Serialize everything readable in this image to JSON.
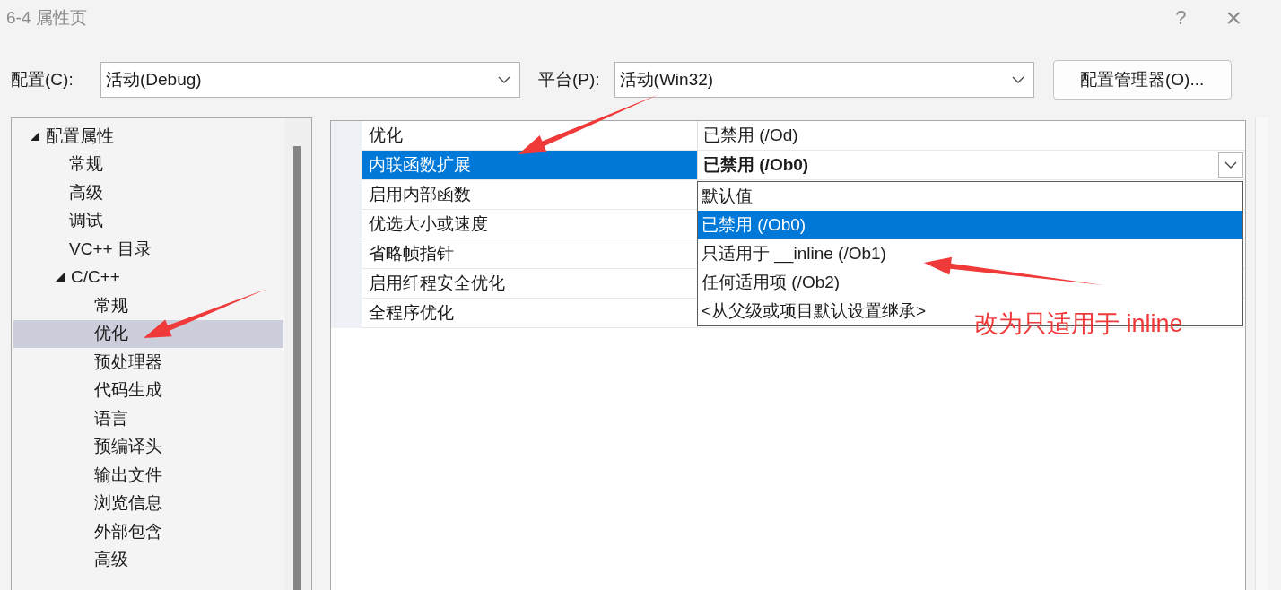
{
  "window": {
    "title": "6-4 属性页",
    "help": "?",
    "close": "×"
  },
  "config": {
    "label": "配置(C):",
    "value": "活动(Debug)"
  },
  "platform": {
    "label": "平台(P):",
    "value": "活动(Win32)"
  },
  "manager_button": "配置管理器(O)...",
  "tree": [
    {
      "label": "配置属性",
      "expanded": true,
      "selected": false,
      "children": [
        {
          "label": "常规",
          "selected": false
        },
        {
          "label": "高级",
          "selected": false
        },
        {
          "label": "调试",
          "selected": false
        },
        {
          "label": "VC++ 目录",
          "selected": false
        },
        {
          "label": "C/C++",
          "expanded": true,
          "selected": false,
          "children": [
            {
              "label": "常规",
              "selected": false
            },
            {
              "label": "优化",
              "selected": true
            },
            {
              "label": "预处理器",
              "selected": false
            },
            {
              "label": "代码生成",
              "selected": false
            },
            {
              "label": "语言",
              "selected": false
            },
            {
              "label": "预编译头",
              "selected": false
            },
            {
              "label": "输出文件",
              "selected": false
            },
            {
              "label": "浏览信息",
              "selected": false
            },
            {
              "label": "外部包含",
              "selected": false
            },
            {
              "label": "高级",
              "selected": false
            }
          ]
        }
      ]
    }
  ],
  "properties": [
    {
      "name": "优化",
      "value": "已禁用 (/Od)",
      "modified": false,
      "selected": false
    },
    {
      "name": "内联函数扩展",
      "value": "已禁用 (/Ob0)",
      "modified": true,
      "selected": true
    },
    {
      "name": "启用内部函数",
      "selected": false
    },
    {
      "name": "优选大小或速度",
      "selected": false
    },
    {
      "name": "省略帧指针",
      "selected": false
    },
    {
      "name": "启用纤程安全优化",
      "selected": false
    },
    {
      "name": "全程序优化",
      "selected": false
    }
  ],
  "dropdown": {
    "options": [
      {
        "label": "默认值",
        "selected": false
      },
      {
        "label": "已禁用 (/Ob0)",
        "selected": true
      },
      {
        "label": "只适用于 __inline (/Ob1)",
        "selected": false
      },
      {
        "label": "任何适用项 (/Ob2)",
        "selected": false
      },
      {
        "label": "<从父级或项目默认设置继承>",
        "selected": false
      }
    ]
  },
  "annotation": "改为只适用于 inline"
}
